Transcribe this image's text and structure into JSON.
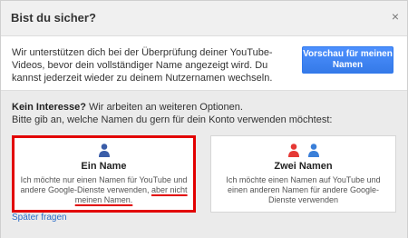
{
  "dialog": {
    "title": "Bist du sicher?",
    "close_glyph": "×"
  },
  "intro": {
    "text": "Wir unterstützen dich bei der Überprüfung deiner YouTube-Videos, bevor dein vollständiger Name angezeigt wird. Du kannst jederzeit wieder zu deinem Nutzernamen wechseln.",
    "preview_button": "Vorschau für meinen Namen"
  },
  "options": {
    "question_bold": "Kein Interesse?",
    "question_rest": " Wir arbeiten an weiteren Optionen.",
    "question_line2": "Bitte gib an, welche Namen du gern für dein Konto verwenden möchtest:",
    "one_name": {
      "title": "Ein Name",
      "desc_part1": "Ich möchte nur einen Namen für YouTube und andere Google-Dienste verwenden, ",
      "desc_part2": "aber nicht meinen Namen.",
      "icon_color": "#3a5da8"
    },
    "two_names": {
      "title": "Zwei Namen",
      "desc": "Ich möchte einen Namen auf YouTube und einen anderen Namen für andere Google-Dienste verwenden",
      "icon_colors": [
        "#e53935",
        "#3a7fd8"
      ]
    }
  },
  "later_link": "Später fragen",
  "colors": {
    "highlight": "#e20000",
    "primary_button": "#4d90fe",
    "link": "#2a6dc9"
  }
}
